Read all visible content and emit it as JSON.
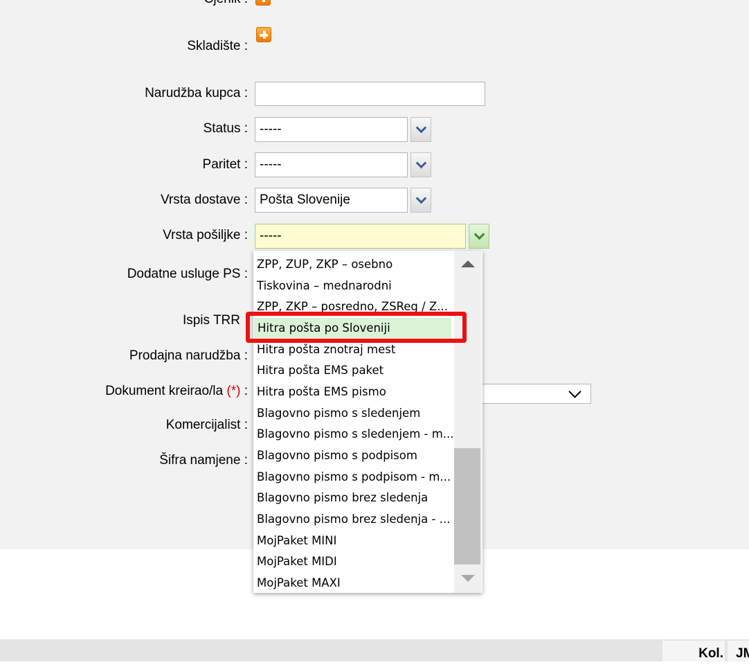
{
  "form": {
    "labels": {
      "ojnik": "Cjenik :",
      "skladiste": "Skladište :",
      "narudzba_kupca": "Narudžba kupca :",
      "status": "Status :",
      "paritet": "Paritet :",
      "vrsta_dostave": "Vrsta dostave :",
      "vrsta_posiljke": "Vrsta pošiljke :",
      "dodatne_usluge": "Dodatne usluge PS :",
      "ispis_trr": "Ispis TRR",
      "prodajna_narudzba": "Prodajna narudžba :",
      "dokument_kreirao": "Dokument kreirao/la",
      "dokument_req": "(*)",
      "dokument_colon": ":",
      "komercijalist": "Komercijalist :",
      "sifra_namjene": "Šifra namjene :"
    },
    "values": {
      "narudzba_kupca": "",
      "status": "-----",
      "paritet": "-----",
      "vrsta_dostave": "Pošta Slovenije",
      "vrsta_posiljke": "-----"
    }
  },
  "dropdown": {
    "items": [
      "ZPP, ZUP, ZKP – osebno",
      "Tiskovina – mednarodni",
      "ZPP, ZKP – posredno, ZSReg / Z...",
      "Hitra pošta po Sloveniji",
      "Hitra pošta znotraj mest",
      "Hitra pošta EMS paket",
      "Hitra pošta EMS pismo",
      "Blagovno pismo s sledenjem",
      "Blagovno pismo s sledenjem - m...",
      "Blagovno pismo s podpisom",
      "Blagovno pismo s podpisom - m...",
      "Blagovno pismo brez sledenja",
      "Blagovno pismo brez sledenja - ...",
      "MojPaket MINI",
      "MojPaket MIDI",
      "MojPaket MAXI"
    ],
    "selected_index": 3
  },
  "footer": {
    "col_kol": "Kol.",
    "col_jm": "JM"
  },
  "colors": {
    "highlight": "#ee1111",
    "selected_item": "#dcf2d7",
    "active_field": "#fdfdcf",
    "required": "#e00000"
  },
  "icons": {
    "add": "plus-icon",
    "combo": "chevron-down-icon"
  }
}
